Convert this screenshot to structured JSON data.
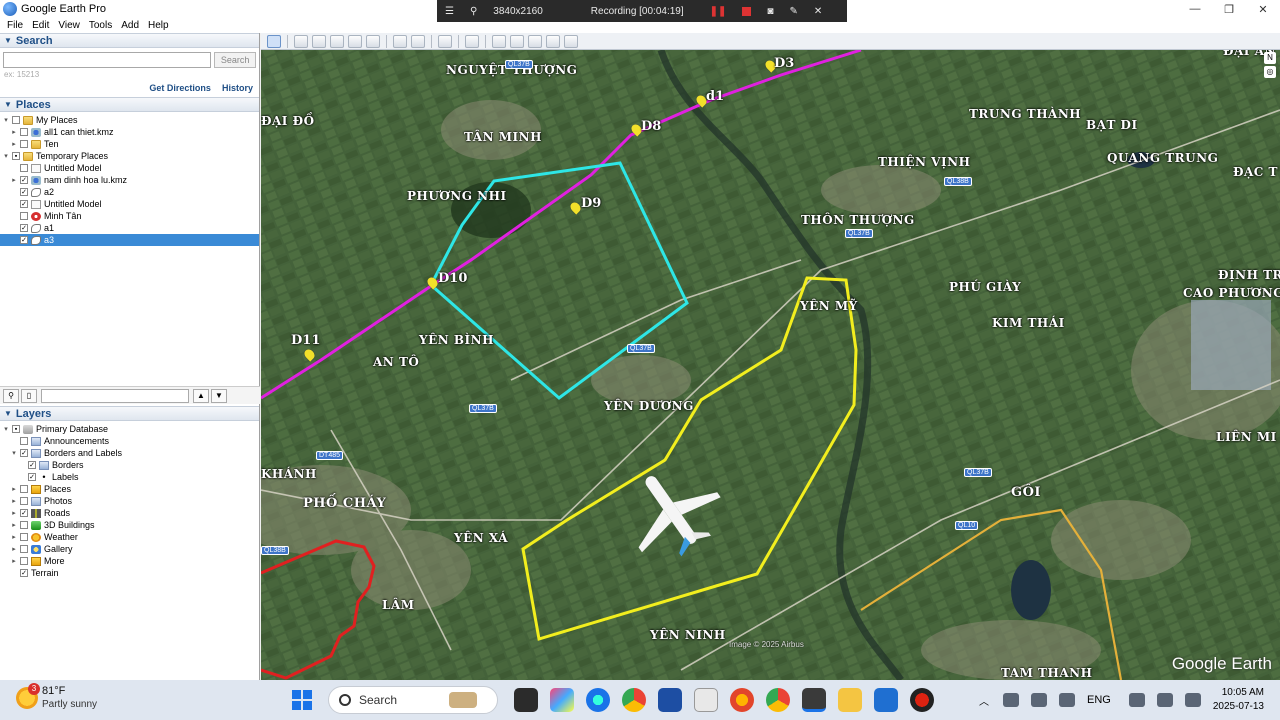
{
  "window": {
    "title": "Google Earth Pro",
    "controls": [
      "—",
      "❐",
      "✕"
    ]
  },
  "recording": {
    "resolution": "3840x2160",
    "status": "Recording [00:04:19]"
  },
  "menu": [
    "File",
    "Edit",
    "View",
    "Tools",
    "Add",
    "Help"
  ],
  "search": {
    "header": "Search",
    "placeholder": "",
    "button": "Search",
    "hint": "ex: 15213",
    "get_directions": "Get Directions",
    "history": "History"
  },
  "places": {
    "header": "Places",
    "items": [
      {
        "label": "My Places"
      },
      {
        "label": "all1 can thiet.kmz"
      },
      {
        "label": "Ten"
      },
      {
        "label": "Temporary Places"
      },
      {
        "label": "Untitled Model"
      },
      {
        "label": "nam dinh hoa lu.kmz"
      },
      {
        "label": "a2"
      },
      {
        "label": "Untitled Model"
      },
      {
        "label": "Minh Tân"
      },
      {
        "label": "a1"
      },
      {
        "label": "a3"
      }
    ]
  },
  "layers": {
    "header": "Layers",
    "items": [
      {
        "label": "Primary Database"
      },
      {
        "label": "Announcements"
      },
      {
        "label": "Borders and Labels"
      },
      {
        "label": "Borders"
      },
      {
        "label": "Labels"
      },
      {
        "label": "Places"
      },
      {
        "label": "Photos"
      },
      {
        "label": "Roads"
      },
      {
        "label": "3D Buildings"
      },
      {
        "label": "Weather"
      },
      {
        "label": "Gallery"
      },
      {
        "label": "More"
      },
      {
        "label": "Terrain"
      }
    ]
  },
  "map": {
    "labels": [
      {
        "text": "NGUYỆT THƯỢNG"
      },
      {
        "text": "TÂN MINH"
      },
      {
        "text": "PHƯƠNG NHI"
      },
      {
        "text": "YÊN BÌNH"
      },
      {
        "text": "AN TÔ"
      },
      {
        "text": "YÊN DƯƠNG"
      },
      {
        "text": "THÔN THƯỢNG"
      },
      {
        "text": "THIỆN VỊNH"
      },
      {
        "text": "TRUNG THÀNH"
      },
      {
        "text": "BẠT DI"
      },
      {
        "text": "QUANG TRUNG"
      },
      {
        "text": "PHÚ GIÀY"
      },
      {
        "text": "KIM THÁI"
      },
      {
        "text": "YÊN MỸ"
      },
      {
        "text": "ĐỊNH TR"
      },
      {
        "text": "CAO PHƯƠNG"
      },
      {
        "text": "LIÊN MI"
      },
      {
        "text": "GÔI"
      },
      {
        "text": "PHỐ CHÁY"
      },
      {
        "text": "YÊN XÁ"
      },
      {
        "text": "LÂM"
      },
      {
        "text": "YÊN NINH"
      },
      {
        "text": "TAM THANH"
      },
      {
        "text": "KHÁNH"
      },
      {
        "text": "ĐẠC T"
      },
      {
        "text": "ĐẠI ĐỒ"
      },
      {
        "text": "ĐẠI AN"
      }
    ],
    "markers": [
      "D3",
      "d1",
      "D8",
      "D9",
      "D10",
      "D11"
    ],
    "road_tags": [
      "QL37B",
      "QL37B",
      "QL37B",
      "QL38B",
      "QL37B",
      "QL37B",
      "DT485",
      "QL10",
      "QL38B"
    ],
    "credit": "Image © 2025 Airbus",
    "logo": "Google Earth",
    "colors": {
      "route": "#e020e0",
      "area_cyan": "#2ee6e6",
      "area_yellow": "#f2ee1e",
      "border_red": "#e02020"
    }
  },
  "taskbar": {
    "weather_temp": "81°F",
    "weather_cond": "Partly sunny",
    "weather_badge": "3",
    "search_label": "Search",
    "lang": "ENG",
    "time": "10:05 AM",
    "date": "2025-07-13"
  }
}
